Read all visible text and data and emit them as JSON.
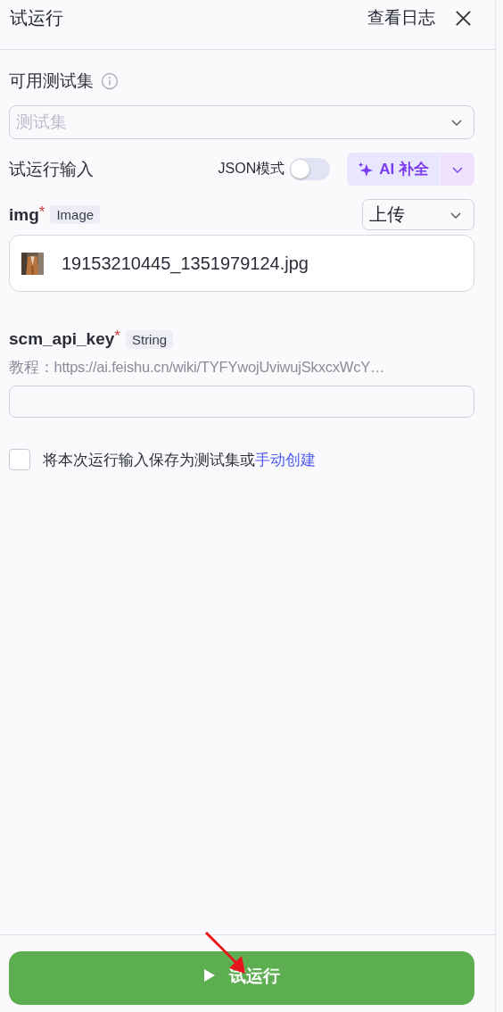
{
  "header": {
    "title": "试运行",
    "view_logs": "查看日志"
  },
  "test_set": {
    "label": "可用测试集",
    "placeholder": "测试集"
  },
  "input_section": {
    "title": "试运行输入",
    "json_mode": {
      "label": "JSON模式",
      "on": false
    },
    "ai_button": "AI 补全"
  },
  "fields": [
    {
      "kind": "file",
      "name": "img",
      "required_mark": "*",
      "type_tag": "Image",
      "mode": "上传",
      "file_name": "19153210445_1351979124.jpg"
    },
    {
      "kind": "text",
      "name": "scm_api_key",
      "required_mark": "*",
      "type_tag": "String",
      "description": "教程：https://ai.feishu.cn/wiki/TYFYwojUviwujSkxcxWcY…"
    }
  ],
  "save_option": {
    "checked": false,
    "text": "将本次运行输入保存为测试集或",
    "link": "手动创建"
  },
  "run_button": "试运行"
}
